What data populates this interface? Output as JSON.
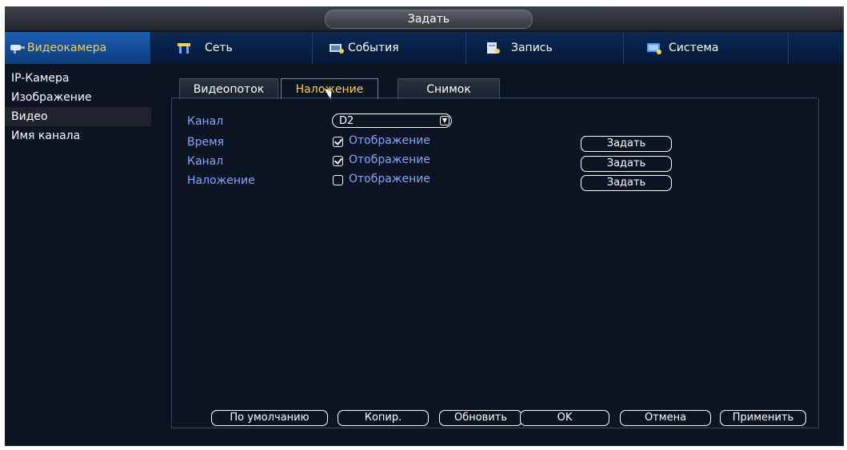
{
  "title": "Задать",
  "menu": [
    {
      "label": "Видеокамера",
      "icon": "camera-icon",
      "active": true
    },
    {
      "label": "Сеть",
      "icon": "network-icon"
    },
    {
      "label": "События",
      "icon": "events-icon"
    },
    {
      "label": "Запись",
      "icon": "record-icon"
    },
    {
      "label": "Система",
      "icon": "system-icon"
    }
  ],
  "sidebar": [
    {
      "label": "IP-Камера"
    },
    {
      "label": "Изображение"
    },
    {
      "label": "Видео",
      "active": true
    },
    {
      "label": "Имя канала"
    }
  ],
  "tabs": [
    {
      "label": "Видеопоток"
    },
    {
      "label": "Наложение",
      "active": true
    },
    {
      "label": "Снимок"
    }
  ],
  "form": {
    "channel_label": "Канал",
    "channel_value": "D2",
    "rows": [
      {
        "label": "Время",
        "checkbox_label": "Отображение",
        "checked": true,
        "button": "Задать"
      },
      {
        "label": "Канал",
        "checkbox_label": "Отображение",
        "checked": true,
        "button": "Задать"
      },
      {
        "label": "Наложение",
        "checkbox_label": "Отображение",
        "checked": false,
        "button": "Задать"
      }
    ]
  },
  "footer": {
    "default": "По умолчанию",
    "copy": "Копир.",
    "refresh": "Обновить",
    "ok": "OK",
    "cancel": "Отмена",
    "apply": "Применить"
  },
  "colors": {
    "background": "#0d1422",
    "accent": "#f5d24a",
    "label_blue": "#7ea7ff",
    "menu_active": "#1e5fb2"
  }
}
